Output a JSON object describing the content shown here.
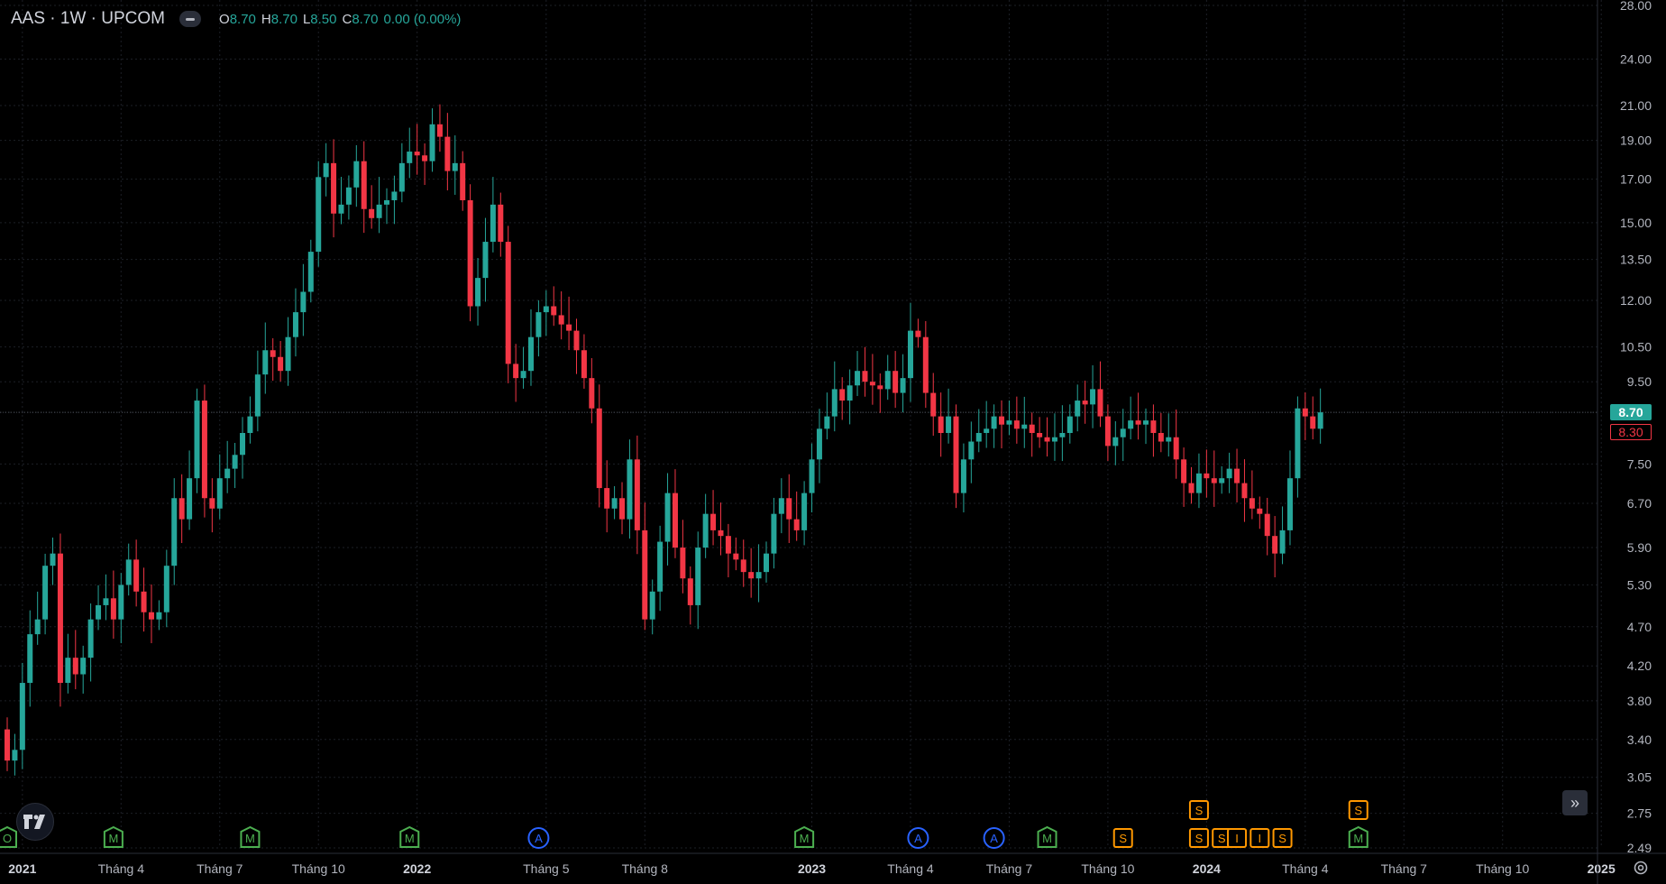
{
  "header": {
    "symbol": "AAS · 1W · UPCOM",
    "o_label": "O",
    "o_value": "8.70",
    "h_label": "H",
    "h_value": "8.70",
    "l_label": "L",
    "l_value": "8.50",
    "c_label": "C",
    "c_value": "8.70",
    "change": "0.00 (0.00%)"
  },
  "colors": {
    "up": "#26a69a",
    "down": "#f23645",
    "grid": "#1c1f26",
    "axis_text": "#b2b5be",
    "dividend": "#ff9800",
    "earnings": "#2962ff",
    "meeting": "#4caf50"
  },
  "price_tags": {
    "last": "8.70",
    "previous": "8.30"
  },
  "icons": {
    "logo": "tradingview-logo-icon",
    "scroll": "scroll-to-realtime-icon",
    "settings": "settings-gear-icon"
  },
  "chart_data": {
    "type": "candlestick",
    "title": "AAS · 1W · UPCOM",
    "scale": "log",
    "ylim": [
      2.49,
      28.0
    ],
    "y_ticks": [
      "28.00",
      "24.00",
      "21.00",
      "19.00",
      "17.00",
      "15.00",
      "13.50",
      "12.00",
      "10.50",
      "9.50",
      "8.70",
      "7.50",
      "6.70",
      "5.90",
      "5.30",
      "4.70",
      "4.20",
      "3.80",
      "3.40",
      "3.05",
      "2.75",
      "2.49"
    ],
    "x_labels": [
      {
        "label": "2021",
        "bold": true,
        "week": 2
      },
      {
        "label": "Tháng 4",
        "week": 15
      },
      {
        "label": "Tháng 7",
        "week": 28
      },
      {
        "label": "Tháng 10",
        "week": 41
      },
      {
        "label": "2022",
        "bold": true,
        "week": 54
      },
      {
        "label": "Tháng 5",
        "week": 71
      },
      {
        "label": "Tháng 8",
        "week": 84
      },
      {
        "label": "2023",
        "bold": true,
        "week": 106
      },
      {
        "label": "Tháng 4",
        "week": 119
      },
      {
        "label": "Tháng 7",
        "week": 132
      },
      {
        "label": "Tháng 10",
        "week": 145
      },
      {
        "label": "2024",
        "bold": true,
        "week": 158
      },
      {
        "label": "Tháng 4",
        "week": 171
      },
      {
        "label": "Tháng 7",
        "week": 184
      },
      {
        "label": "Tháng 10",
        "week": 197
      },
      {
        "label": "2025",
        "bold": true,
        "week": 210
      }
    ],
    "grid": true,
    "current_price": 8.7,
    "candles": [
      [
        3.5,
        3.2
      ],
      [
        3.2,
        3.3
      ],
      [
        3.3,
        4.0
      ],
      [
        4.0,
        4.6
      ],
      [
        4.6,
        4.8
      ],
      [
        4.8,
        5.6
      ],
      [
        5.6,
        5.8
      ],
      [
        5.8,
        4.0
      ],
      [
        4.0,
        4.3
      ],
      [
        4.3,
        4.1
      ],
      [
        4.1,
        4.3
      ],
      [
        4.3,
        4.8
      ],
      [
        4.8,
        5.0
      ],
      [
        5.0,
        5.1
      ],
      [
        5.1,
        4.8
      ],
      [
        4.8,
        5.3
      ],
      [
        5.3,
        5.7
      ],
      [
        5.7,
        5.2
      ],
      [
        5.2,
        4.9
      ],
      [
        4.9,
        4.8
      ],
      [
        4.8,
        4.9
      ],
      [
        4.9,
        5.6
      ],
      [
        5.6,
        6.8
      ],
      [
        6.8,
        6.4
      ],
      [
        6.4,
        7.2
      ],
      [
        7.2,
        9.0
      ],
      [
        9.0,
        6.8
      ],
      [
        6.8,
        6.6
      ],
      [
        6.6,
        7.2
      ],
      [
        7.2,
        7.4
      ],
      [
        7.4,
        7.7
      ],
      [
        7.7,
        8.2
      ],
      [
        8.2,
        8.6
      ],
      [
        8.6,
        9.7
      ],
      [
        9.7,
        10.4
      ],
      [
        10.4,
        10.2
      ],
      [
        10.2,
        9.8
      ],
      [
        9.8,
        10.8
      ],
      [
        10.8,
        11.6
      ],
      [
        11.6,
        12.3
      ],
      [
        12.3,
        13.8
      ],
      [
        13.8,
        17.1
      ],
      [
        17.1,
        17.8
      ],
      [
        17.8,
        15.4
      ],
      [
        15.4,
        15.8
      ],
      [
        15.8,
        16.6
      ],
      [
        16.6,
        17.9
      ],
      [
        17.9,
        15.6
      ],
      [
        15.6,
        15.2
      ],
      [
        15.2,
        15.8
      ],
      [
        15.8,
        16.0
      ],
      [
        16.0,
        16.4
      ],
      [
        16.4,
        17.8
      ],
      [
        17.8,
        18.4
      ],
      [
        18.4,
        18.2
      ],
      [
        18.2,
        17.9
      ],
      [
        17.9,
        19.9
      ],
      [
        19.9,
        19.2
      ],
      [
        19.2,
        17.4
      ],
      [
        17.4,
        17.8
      ],
      [
        17.8,
        16.0
      ],
      [
        16.0,
        11.8
      ],
      [
        11.8,
        12.8
      ],
      [
        12.8,
        14.2
      ],
      [
        14.2,
        15.8
      ],
      [
        15.8,
        14.2
      ],
      [
        14.2,
        10.0
      ],
      [
        10.0,
        9.6
      ],
      [
        9.6,
        9.8
      ],
      [
        9.8,
        10.8
      ],
      [
        10.8,
        11.6
      ],
      [
        11.6,
        11.8
      ],
      [
        11.8,
        11.5
      ],
      [
        11.5,
        11.2
      ],
      [
        11.2,
        11.0
      ],
      [
        11.0,
        10.4
      ],
      [
        10.4,
        9.6
      ],
      [
        9.6,
        8.8
      ],
      [
        8.8,
        7.0
      ],
      [
        7.0,
        6.6
      ],
      [
        6.6,
        6.8
      ],
      [
        6.8,
        6.4
      ],
      [
        6.4,
        7.6
      ],
      [
        7.6,
        6.2
      ],
      [
        6.2,
        4.8
      ],
      [
        4.8,
        5.2
      ],
      [
        5.2,
        6.0
      ],
      [
        6.0,
        6.9
      ],
      [
        6.9,
        5.9
      ],
      [
        5.9,
        5.4
      ],
      [
        5.4,
        5.0
      ],
      [
        5.0,
        5.9
      ],
      [
        5.9,
        6.5
      ],
      [
        6.5,
        6.2
      ],
      [
        6.2,
        6.1
      ],
      [
        6.1,
        5.8
      ],
      [
        5.8,
        5.7
      ],
      [
        5.7,
        5.5
      ],
      [
        5.5,
        5.4
      ],
      [
        5.4,
        5.5
      ],
      [
        5.5,
        5.8
      ],
      [
        5.8,
        6.5
      ],
      [
        6.5,
        6.8
      ],
      [
        6.8,
        6.4
      ],
      [
        6.4,
        6.2
      ],
      [
        6.2,
        6.9
      ],
      [
        6.9,
        7.6
      ],
      [
        7.6,
        8.3
      ],
      [
        8.3,
        8.6
      ],
      [
        8.6,
        9.3
      ],
      [
        9.3,
        9.0
      ],
      [
        9.0,
        9.4
      ],
      [
        9.4,
        9.8
      ],
      [
        9.8,
        9.5
      ],
      [
        9.5,
        9.4
      ],
      [
        9.4,
        9.3
      ],
      [
        9.3,
        9.8
      ],
      [
        9.8,
        9.2
      ],
      [
        9.2,
        9.6
      ],
      [
        9.6,
        11.0
      ],
      [
        11.0,
        10.8
      ],
      [
        10.8,
        9.2
      ],
      [
        9.2,
        8.6
      ],
      [
        8.6,
        8.2
      ],
      [
        8.2,
        8.6
      ],
      [
        8.6,
        6.9
      ],
      [
        6.9,
        7.6
      ],
      [
        7.6,
        8.0
      ],
      [
        8.0,
        8.2
      ],
      [
        8.2,
        8.3
      ],
      [
        8.3,
        8.6
      ],
      [
        8.6,
        8.4
      ],
      [
        8.4,
        8.5
      ],
      [
        8.5,
        8.3
      ],
      [
        8.3,
        8.4
      ],
      [
        8.4,
        8.2
      ],
      [
        8.2,
        8.1
      ],
      [
        8.1,
        8.0
      ],
      [
        8.0,
        8.1
      ],
      [
        8.1,
        8.2
      ],
      [
        8.2,
        8.6
      ],
      [
        8.6,
        9.0
      ],
      [
        9.0,
        8.9
      ],
      [
        8.9,
        9.3
      ],
      [
        9.3,
        8.6
      ],
      [
        8.6,
        7.9
      ],
      [
        7.9,
        8.1
      ],
      [
        8.1,
        8.3
      ],
      [
        8.3,
        8.5
      ],
      [
        8.5,
        8.4
      ],
      [
        8.4,
        8.5
      ],
      [
        8.5,
        8.2
      ],
      [
        8.2,
        8.0
      ],
      [
        8.0,
        8.1
      ],
      [
        8.1,
        7.6
      ],
      [
        7.6,
        7.1
      ],
      [
        7.1,
        6.9
      ],
      [
        6.9,
        7.3
      ],
      [
        7.3,
        7.2
      ],
      [
        7.2,
        7.1
      ],
      [
        7.1,
        7.2
      ],
      [
        7.2,
        7.4
      ],
      [
        7.4,
        7.1
      ],
      [
        7.1,
        6.8
      ],
      [
        6.8,
        6.6
      ],
      [
        6.6,
        6.5
      ],
      [
        6.5,
        6.1
      ],
      [
        6.1,
        5.8
      ],
      [
        5.8,
        6.2
      ],
      [
        6.2,
        7.2
      ],
      [
        7.2,
        8.8
      ],
      [
        8.8,
        8.6
      ],
      [
        8.6,
        8.3
      ],
      [
        8.3,
        8.7
      ]
    ],
    "events": [
      {
        "label": "O",
        "kind": "meeting",
        "week": 0,
        "row": 0
      },
      {
        "label": "M",
        "kind": "meeting",
        "week": 14,
        "row": 0
      },
      {
        "label": "M",
        "kind": "meeting",
        "week": 32,
        "row": 0
      },
      {
        "label": "M",
        "kind": "meeting",
        "week": 53,
        "row": 0
      },
      {
        "label": "A",
        "kind": "earnings",
        "week": 70,
        "row": 0
      },
      {
        "label": "M",
        "kind": "meeting",
        "week": 105,
        "row": 0
      },
      {
        "label": "A",
        "kind": "earnings",
        "week": 120,
        "row": 0
      },
      {
        "label": "A",
        "kind": "earnings",
        "week": 130,
        "row": 0
      },
      {
        "label": "M",
        "kind": "meeting",
        "week": 137,
        "row": 0
      },
      {
        "label": "S",
        "kind": "dividend",
        "week": 147,
        "row": 0
      },
      {
        "label": "S",
        "kind": "dividend",
        "week": 157,
        "row": 1
      },
      {
        "label": "S",
        "kind": "dividend",
        "week": 157,
        "row": 0
      },
      {
        "label": "S",
        "kind": "dividend",
        "week": 160,
        "row": 0
      },
      {
        "label": "I",
        "kind": "dividend",
        "week": 162,
        "row": 0
      },
      {
        "label": "I",
        "kind": "dividend",
        "week": 165,
        "row": 0
      },
      {
        "label": "S",
        "kind": "dividend",
        "week": 168,
        "row": 0
      },
      {
        "label": "S",
        "kind": "dividend",
        "week": 178,
        "row": 1
      },
      {
        "label": "M",
        "kind": "meeting",
        "week": 178,
        "row": 0
      }
    ]
  }
}
